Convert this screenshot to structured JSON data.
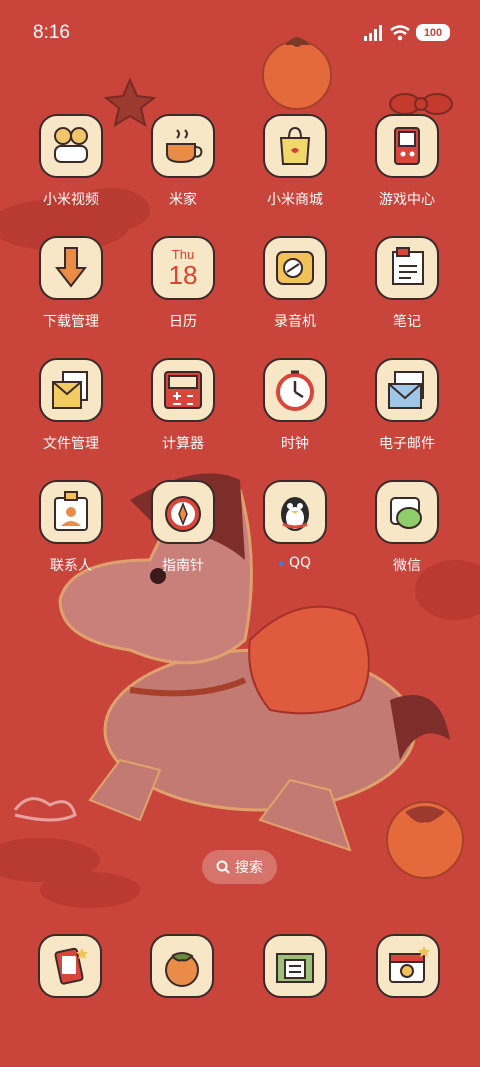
{
  "status_bar": {
    "time": "8:16",
    "battery": "100"
  },
  "apps": [
    {
      "label": "小米视频",
      "icon": "video-icon"
    },
    {
      "label": "米家",
      "icon": "tea-cup-icon"
    },
    {
      "label": "小米商城",
      "icon": "shopping-bag-icon"
    },
    {
      "label": "游戏中心",
      "icon": "game-console-icon"
    },
    {
      "label": "下载管理",
      "icon": "download-arrow-icon"
    },
    {
      "label": "日历",
      "icon": "calendar-icon",
      "day": "Thu",
      "date": "18"
    },
    {
      "label": "录音机",
      "icon": "recorder-icon"
    },
    {
      "label": "笔记",
      "icon": "notes-icon"
    },
    {
      "label": "文件管理",
      "icon": "folder-icon"
    },
    {
      "label": "计算器",
      "icon": "calculator-icon"
    },
    {
      "label": "时钟",
      "icon": "clock-icon"
    },
    {
      "label": "电子邮件",
      "icon": "mail-icon"
    },
    {
      "label": "联系人",
      "icon": "contacts-icon"
    },
    {
      "label": "指南针",
      "icon": "compass-icon"
    },
    {
      "label": "QQ",
      "icon": "qq-penguin-icon",
      "new_dot": true
    },
    {
      "label": "微信",
      "icon": "wechat-icon"
    }
  ],
  "search": {
    "label": "搜索",
    "icon": "search-icon"
  },
  "dock": [
    {
      "icon": "phone-icon"
    },
    {
      "icon": "persimmon-icon"
    },
    {
      "icon": "messages-icon"
    },
    {
      "icon": "camera-icon"
    }
  ],
  "colors": {
    "background": "#c9443a",
    "icon_bg": "#f8e7c6",
    "outline": "#3a2a2a"
  }
}
